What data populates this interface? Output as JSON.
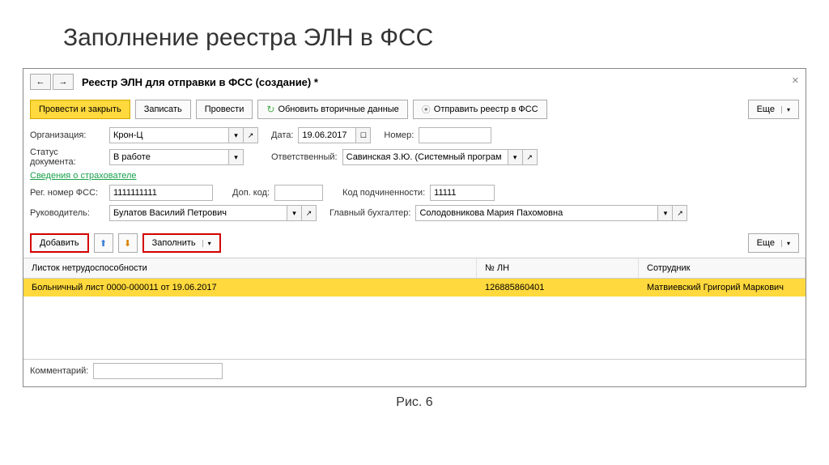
{
  "page": {
    "title": "Заполнение реестра ЭЛН в ФСС",
    "caption": "Рис. 6"
  },
  "window": {
    "title": "Реестр ЭЛН для отправки в ФСС (создание) *"
  },
  "toolbar": {
    "post_close": "Провести и закрыть",
    "save": "Записать",
    "post": "Провести",
    "refresh": "Обновить вторичные данные",
    "send": "Отправить реестр в ФСС",
    "more": "Еще"
  },
  "form": {
    "org_label": "Организация:",
    "org_value": "Крон-Ц",
    "date_label": "Дата:",
    "date_value": "19.06.2017",
    "number_label": "Номер:",
    "status_label": "Статус документа:",
    "status_value": "В работе",
    "resp_label": "Ответственный:",
    "resp_value": "Савинская З.Ю. (Системный програм",
    "section_link": "Сведения о страхователе",
    "regnum_label": "Рег. номер ФСС:",
    "regnum_value": "1111111111",
    "dopkod_label": "Доп. код:",
    "subcode_label": "Код подчиненности:",
    "subcode_value": "11111",
    "head_label": "Руководитель:",
    "head_value": "Булатов Василий Петрович",
    "acct_label": "Главный бухгалтер:",
    "acct_value": "Солодовникова Мария Пахомовна",
    "comment_label": "Комментарий:"
  },
  "table_toolbar": {
    "add": "Добавить",
    "fill": "Заполнить",
    "more": "Еще"
  },
  "table": {
    "headers": {
      "c1": "Листок нетрудоспособности",
      "c2": "№ ЛН",
      "c3": "Сотрудник"
    },
    "rows": [
      {
        "c1": "Больничный лист 0000-000011 от 19.06.2017",
        "c2": "126885860401",
        "c3": "Матвиевский Григорий Маркович"
      }
    ]
  }
}
